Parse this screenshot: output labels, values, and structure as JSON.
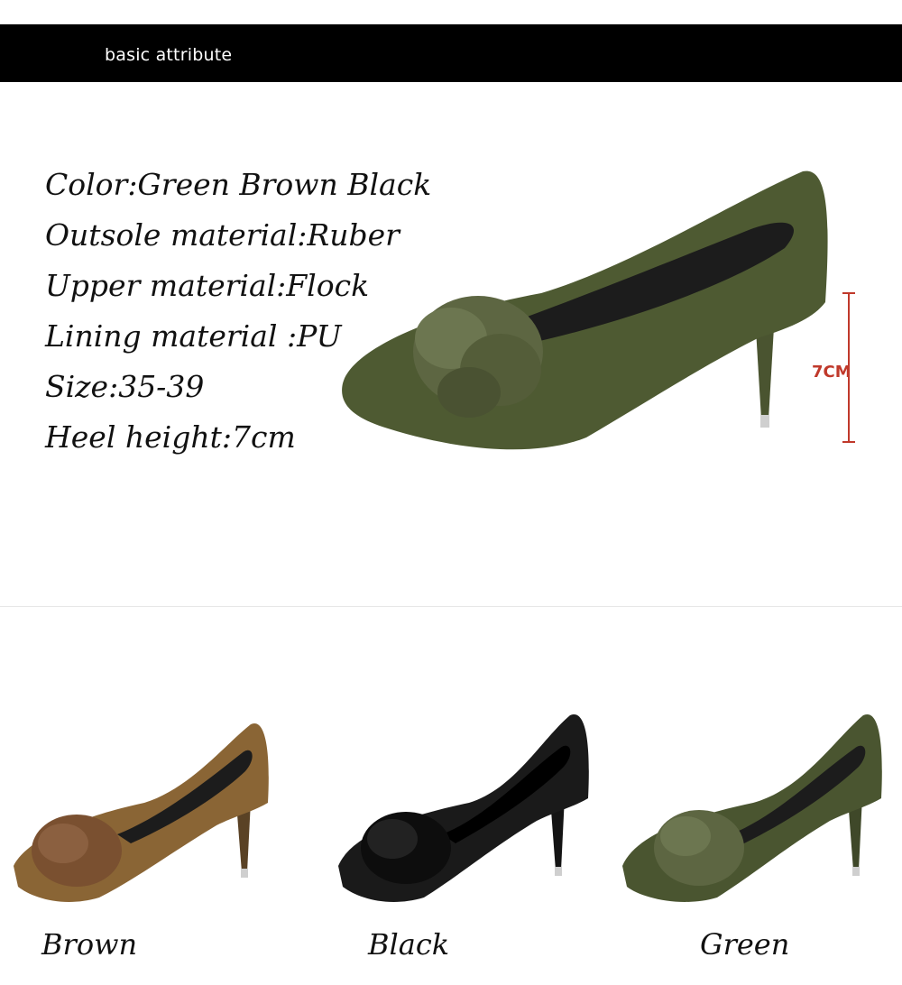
{
  "header": {
    "title": "basic attribute"
  },
  "attributes": [
    "Color:Green Brown Black",
    "Outsole material:Ruber",
    "Upper material:Flock",
    "Lining material :PU",
    "Size:35-39",
    "Heel height:7cm"
  ],
  "measurement": {
    "label": "7CM"
  },
  "variants": [
    {
      "label": "Brown",
      "color": "#8a6535"
    },
    {
      "label": "Black",
      "color": "#1a1a1a"
    },
    {
      "label": "Green",
      "color": "#4a5530"
    }
  ],
  "colors": {
    "main_shoe": "#4e5a32",
    "measure_line": "#c0392b"
  }
}
